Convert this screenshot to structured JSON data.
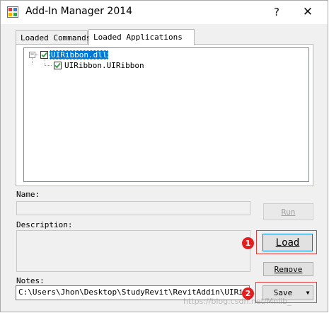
{
  "window": {
    "title": "Add-In Manager 2014",
    "help_glyph": "?",
    "close_glyph": "✕"
  },
  "tabs": [
    {
      "label": "Loaded Commands",
      "active": false
    },
    {
      "label": "Loaded Applications",
      "active": true
    }
  ],
  "tree": {
    "root": {
      "label": "UIRibbon.dll",
      "expander": "−",
      "checked": true,
      "selected": true
    },
    "children": [
      {
        "label": "UIRibbon.UIRibbon",
        "checked": true
      }
    ]
  },
  "labels": {
    "name": "Name:",
    "description": "Description:",
    "notes": "Notes:"
  },
  "fields": {
    "name_value": "",
    "description_value": "",
    "notes_value": "C:\\Users\\Jhon\\Desktop\\StudyRevit\\RevitAddin\\UIRibbon\\"
  },
  "buttons": {
    "run": "Run",
    "load": "Load",
    "remove": "Remove",
    "save": "Save",
    "save_arrow": "▼"
  },
  "annotations": {
    "marker_1": "1",
    "marker_2": "2",
    "highlight_color": "#e04040"
  },
  "watermark": "https://blog.csdn.net/Mnlib_"
}
